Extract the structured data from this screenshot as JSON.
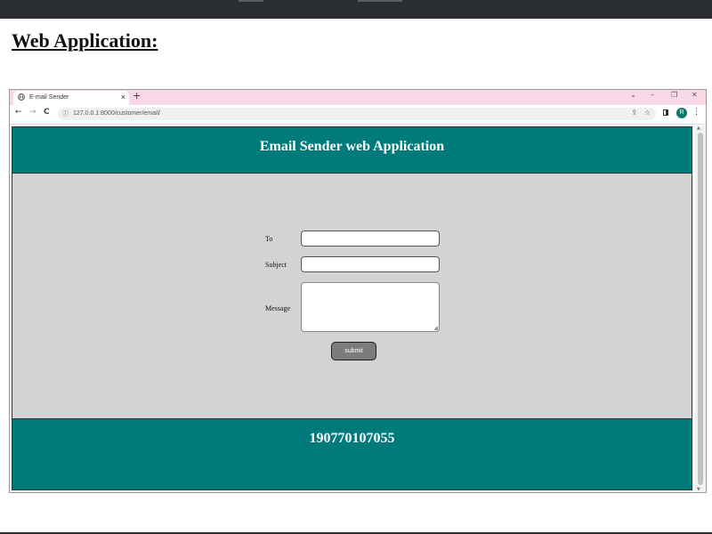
{
  "document": {
    "heading": "Web Application:"
  },
  "browser": {
    "tab_title": "E-mail Sender",
    "tab_close": "×",
    "new_tab": "+",
    "window_controls": {
      "tabs_menu": "⌄",
      "minimize": "–",
      "restore": "❐",
      "close": "✕"
    },
    "nav": {
      "back": "←",
      "forward": "→",
      "reload": "C"
    },
    "url": "127.0.0.1:8000/customer/email/",
    "profile_initial": "R"
  },
  "app": {
    "title": "Email Sender web Application",
    "form": {
      "to_label": "To",
      "to_value": "",
      "subject_label": "Subject",
      "subject_value": "",
      "message_label": "Message",
      "message_value": "",
      "submit_label": "submit"
    },
    "footer_text": "190770107055"
  },
  "colors": {
    "teal": "#007b7c",
    "form_bg": "#d3d3d3",
    "tabstrip": "#f8d7e6",
    "submit_bg": "#7c7c7c"
  }
}
